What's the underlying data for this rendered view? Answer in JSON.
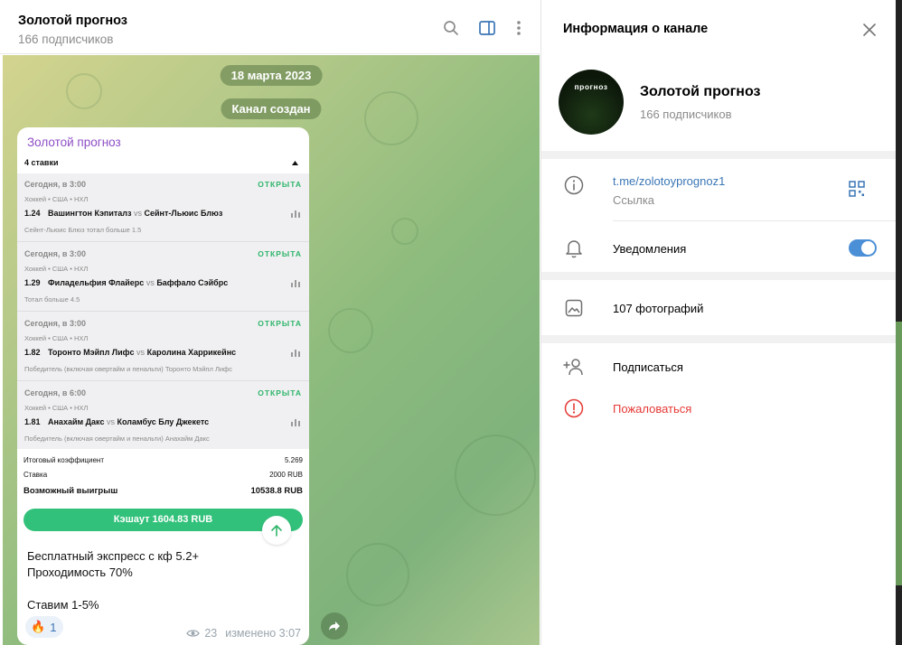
{
  "chat": {
    "title": "Золотой прогноз",
    "subtitle": "166 подписчиков",
    "date_pill": "18 марта 2023",
    "service_pill": "Канал создан"
  },
  "message": {
    "author": "Золотой прогноз",
    "bet_slip": {
      "header": "4 ставки",
      "items": [
        {
          "time": "Сегодня, в 3:00",
          "status": "ОТКРЫТА",
          "league": "Хоккей • США • НХЛ",
          "odd": "1.24",
          "team1": "Вашингтон Кэпиталз",
          "vs": "vs",
          "team2": "Сейнт-Льюис Блюз",
          "note": "Сейнт-Льюис Блюз тотал больше 1.5"
        },
        {
          "time": "Сегодня, в 3:00",
          "status": "ОТКРЫТА",
          "league": "Хоккей • США • НХЛ",
          "odd": "1.29",
          "team1": "Филадельфия Флайерс",
          "vs": "vs",
          "team2": "Баффало Сэйбрс",
          "note": "Тотал больше 4.5"
        },
        {
          "time": "Сегодня, в 3:00",
          "status": "ОТКРЫТА",
          "league": "Хоккей • США • НХЛ",
          "odd": "1.82",
          "team1": "Торонто Мэйпл Лифс",
          "vs": "vs",
          "team2": "Каролина Харрикейнс",
          "note": "Победитель (включая овертайм и пенальти) Торонто Мэйпл Лифс"
        },
        {
          "time": "Сегодня, в 6:00",
          "status": "ОТКРЫТА",
          "league": "Хоккей • США • НХЛ",
          "odd": "1.81",
          "team1": "Анахайм Дакс",
          "vs": "vs",
          "team2": "Коламбус Блу Джекетс",
          "note": "Победитель (включая овертайм и пенальти) Анахайм Дакс"
        }
      ],
      "total_coef_label": "Итоговый коэффициент",
      "total_coef_value": "5.269",
      "stake_label": "Ставка",
      "stake_value": "2000 RUB",
      "win_label": "Возможный выигрыш",
      "win_value": "10538.8 RUB",
      "cashout_label": "Кэшаут 1604.83 RUB"
    },
    "text_lines": [
      "Бесплатный экспресс  с кф 5.2+",
      "Проходимость 70%",
      "",
      "Ставим 1-5%"
    ],
    "reaction_emoji": "🔥",
    "reaction_count": "1",
    "views": "23",
    "edited": "изменено 3:07"
  },
  "info": {
    "title": "Информация о канале",
    "avatar_text": "прогноз",
    "name": "Золотой прогноз",
    "subscribers": "166 подписчиков",
    "link": "t.me/zolotoyprognoz1",
    "link_label": "Ссылка",
    "notifications": "Уведомления",
    "notifications_on": true,
    "photos": "107 фотографий",
    "subscribe": "Подписаться",
    "report": "Пожаловаться"
  },
  "colors": {
    "accent": "#3a76b6",
    "author": "#8e4ec6",
    "open_status": "#2fb56a",
    "cashout": "#32c17a",
    "report": "#e53935",
    "toggle": "#4b8fd6"
  }
}
